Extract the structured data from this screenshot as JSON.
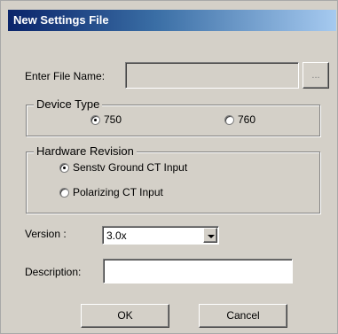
{
  "window": {
    "title": "New Settings File"
  },
  "file_name": {
    "label": "Enter File Name:",
    "value": "",
    "browse_label": "..."
  },
  "device_type": {
    "legend": "Device Type",
    "options": [
      {
        "label": "750",
        "checked": true
      },
      {
        "label": "760",
        "checked": false
      }
    ]
  },
  "hardware_revision": {
    "legend": "Hardware Revision",
    "options": [
      {
        "label": "Senstv Ground CT Input",
        "checked": true
      },
      {
        "label": "Polarizing CT Input",
        "checked": false
      }
    ]
  },
  "version": {
    "label": "Version :",
    "selected": "3.0x"
  },
  "description": {
    "label": "Description:",
    "value": ""
  },
  "buttons": {
    "ok": "OK",
    "cancel": "Cancel"
  },
  "colors": {
    "title_start": "#0a246a",
    "title_end": "#a6caf0",
    "face": "#d4d0c8"
  },
  "icons": {
    "dropdown": "chevron-down-icon",
    "radio_selected": "radio-dot-icon"
  }
}
